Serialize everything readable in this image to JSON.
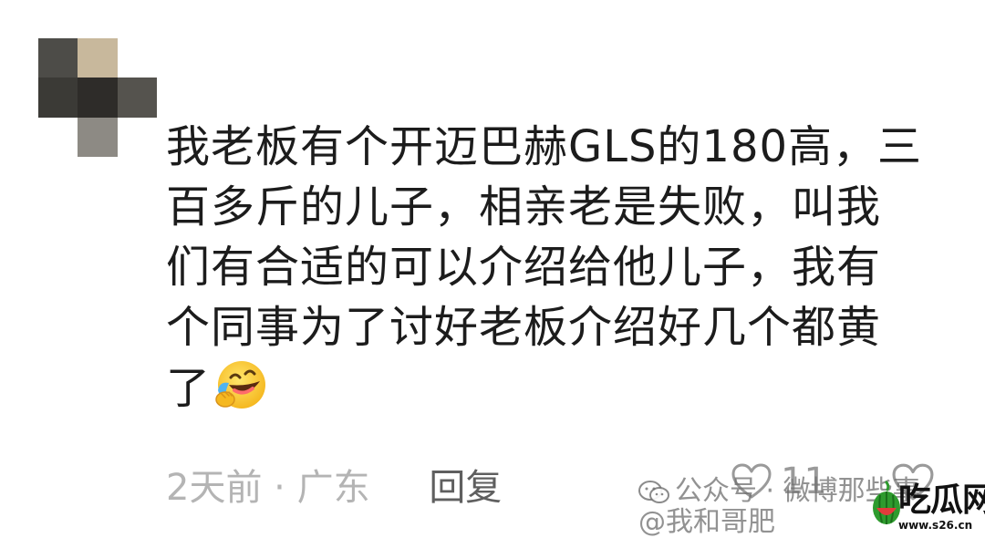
{
  "comment": {
    "lines": [
      "我老板有个开迈巴赫GLS的180高，三",
      "百多斤的儿子，相亲老是失败，叫我",
      "们有合适的可以介绍给他儿子，我有",
      "个同事为了讨好老板介绍好几个都黄",
      "了"
    ],
    "emoji": "laughing-crying-emoji"
  },
  "meta": {
    "time_location": "2天前 · 广东",
    "reply_label": "回复"
  },
  "likes": {
    "count": "11"
  },
  "watermark": {
    "line1": "公众号 · 微博那些事",
    "line2": "@我和哥肥"
  },
  "logo": {
    "title": "吃瓜网",
    "url": "www.s26.cn"
  },
  "colors": {
    "text": "#1c1c1c",
    "meta": "#b4b4b4",
    "reply": "#5f5f5f",
    "avatar_blur": [
      "#4a4a47",
      "#c7b79d",
      "#ffffff",
      "#3c3c38",
      "#2f2d2a",
      "#5d5a55",
      "#ffffff",
      "#6b6863",
      "#ffffff"
    ]
  }
}
